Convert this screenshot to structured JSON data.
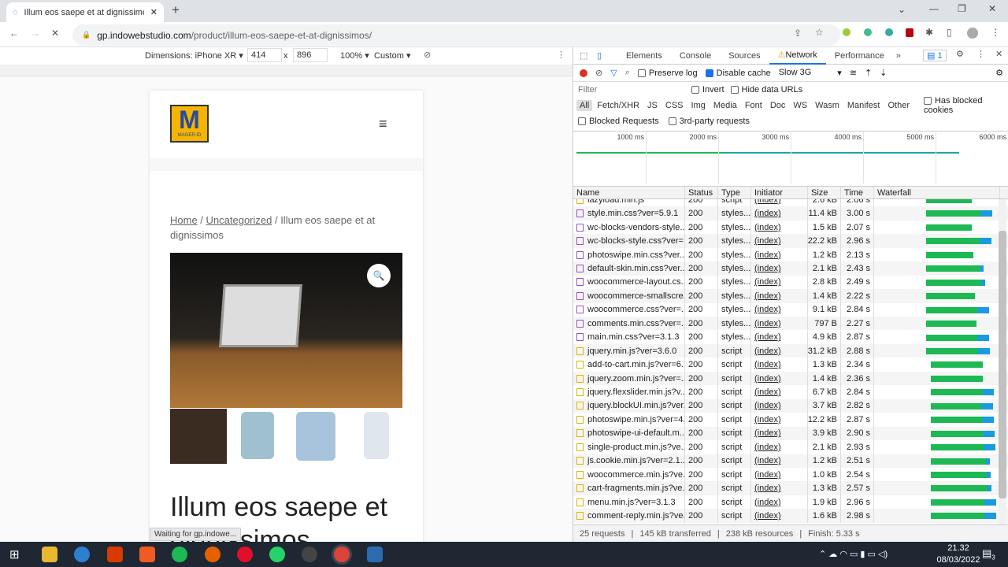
{
  "browser": {
    "tab_title": "Illum eos saepe et at dignissimos",
    "url_host": "gp.indowebstudio.com",
    "url_path": "/product/illum-eos-saepe-et-at-dignissimos/",
    "status_text": "Waiting for gp.indowe..."
  },
  "device_toolbar": {
    "dimensions_label": "Dimensions: iPhone XR",
    "width": "414",
    "height": "896",
    "times": "x",
    "zoom": "100%",
    "throttle": "Custom"
  },
  "page": {
    "breadcrumb_home": "Home",
    "breadcrumb_sep": " / ",
    "breadcrumb_cat": "Uncategorized",
    "breadcrumb_current": " / Illum eos saepe et at dignissimos",
    "title": "Illum eos saepe et dignissimos",
    "logo_text": "M",
    "logo_sub": "MAGER.ID"
  },
  "devtools": {
    "tabs": [
      "Elements",
      "Console",
      "Sources",
      "Network",
      "Performance"
    ],
    "active_tab": "Network",
    "issues_count": "1",
    "preserve_log": "Preserve log",
    "disable_cache": "Disable cache",
    "throttle": "Slow 3G",
    "filter_placeholder": "Filter",
    "invert": "Invert",
    "hide_data_urls": "Hide data URLs",
    "types": [
      "All",
      "Fetch/XHR",
      "JS",
      "CSS",
      "Img",
      "Media",
      "Font",
      "Doc",
      "WS",
      "Wasm",
      "Manifest",
      "Other"
    ],
    "has_blocked_cookies": "Has blocked cookies",
    "blocked_requests": "Blocked Requests",
    "third_party": "3rd-party requests",
    "timeline_ticks": [
      "1000 ms",
      "2000 ms",
      "3000 ms",
      "4000 ms",
      "5000 ms",
      "6000 ms"
    ],
    "columns": [
      "Name",
      "Status",
      "Type",
      "Initiator",
      "Size",
      "Time",
      "Waterfall"
    ],
    "requests": [
      [
        "lazyload.min.js",
        "200",
        "script",
        "(index)",
        "2.6 kB",
        "2.06 s",
        "js"
      ],
      [
        "style.min.css?ver=5.9.1",
        "200",
        "styles...",
        "(index)",
        "11.4 kB",
        "3.00 s",
        "css"
      ],
      [
        "wc-blocks-vendors-style....",
        "200",
        "styles...",
        "(index)",
        "1.5 kB",
        "2.07 s",
        "css"
      ],
      [
        "wc-blocks-style.css?ver=...",
        "200",
        "styles...",
        "(index)",
        "22.2 kB",
        "2.96 s",
        "css"
      ],
      [
        "photoswipe.min.css?ver...",
        "200",
        "styles...",
        "(index)",
        "1.2 kB",
        "2.13 s",
        "css"
      ],
      [
        "default-skin.min.css?ver...",
        "200",
        "styles...",
        "(index)",
        "2.1 kB",
        "2.43 s",
        "css"
      ],
      [
        "woocommerce-layout.cs...",
        "200",
        "styles...",
        "(index)",
        "2.8 kB",
        "2.49 s",
        "css"
      ],
      [
        "woocommerce-smallscre...",
        "200",
        "styles...",
        "(index)",
        "1.4 kB",
        "2.22 s",
        "css"
      ],
      [
        "woocommerce.css?ver=...",
        "200",
        "styles...",
        "(index)",
        "9.1 kB",
        "2.84 s",
        "css"
      ],
      [
        "comments.min.css?ver=...",
        "200",
        "styles...",
        "(index)",
        "797 B",
        "2.27 s",
        "css"
      ],
      [
        "main.min.css?ver=3.1.3",
        "200",
        "styles...",
        "(index)",
        "4.9 kB",
        "2.87 s",
        "css"
      ],
      [
        "jquery.min.js?ver=3.6.0",
        "200",
        "script",
        "(index)",
        "31.2 kB",
        "2.88 s",
        "js"
      ],
      [
        "add-to-cart.min.js?ver=6...",
        "200",
        "script",
        "(index)",
        "1.3 kB",
        "2.34 s",
        "js"
      ],
      [
        "jquery.zoom.min.js?ver=...",
        "200",
        "script",
        "(index)",
        "1.4 kB",
        "2.36 s",
        "js"
      ],
      [
        "jquery.flexslider.min.js?v...",
        "200",
        "script",
        "(index)",
        "6.7 kB",
        "2.84 s",
        "js"
      ],
      [
        "jquery.blockUI.min.js?ver...",
        "200",
        "script",
        "(index)",
        "3.7 kB",
        "2.82 s",
        "js"
      ],
      [
        "photoswipe.min.js?ver=4...",
        "200",
        "script",
        "(index)",
        "12.2 kB",
        "2.87 s",
        "js"
      ],
      [
        "photoswipe-ui-default.m...",
        "200",
        "script",
        "(index)",
        "3.9 kB",
        "2.90 s",
        "js"
      ],
      [
        "single-product.min.js?ve...",
        "200",
        "script",
        "(index)",
        "2.1 kB",
        "2.93 s",
        "js"
      ],
      [
        "js.cookie.min.js?ver=2.1....",
        "200",
        "script",
        "(index)",
        "1.2 kB",
        "2.51 s",
        "js"
      ],
      [
        "woocommerce.min.js?ve...",
        "200",
        "script",
        "(index)",
        "1.0 kB",
        "2.54 s",
        "js"
      ],
      [
        "cart-fragments.min.js?ve...",
        "200",
        "script",
        "(index)",
        "1.3 kB",
        "2.57 s",
        "js"
      ],
      [
        "menu.min.js?ver=3.1.3",
        "200",
        "script",
        "(index)",
        "1.9 kB",
        "2.96 s",
        "js"
      ],
      [
        "comment-reply.min.js?ve...",
        "200",
        "script",
        "(index)",
        "1.6 kB",
        "2.98 s",
        "js"
      ]
    ],
    "summary": {
      "requests": "25 requests",
      "transferred": "145 kB transferred",
      "resources": "238 kB resources",
      "finish": "Finish: 5.33 s"
    }
  },
  "taskbar": {
    "time": "21.32",
    "date": "08/03/2022",
    "notifications": "3"
  },
  "colors": {
    "accent": "#1a73e8",
    "record": "#d93025",
    "waterfall_green": "#1db954",
    "waterfall_blue": "#1a9be0"
  }
}
